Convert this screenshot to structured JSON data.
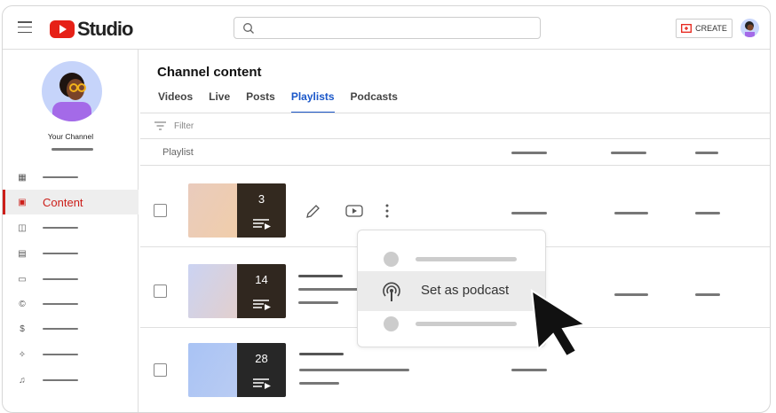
{
  "header": {
    "logo_text": "Studio",
    "create_label": "CREATE",
    "search_placeholder": ""
  },
  "sidebar": {
    "channel_name": "Your Channel",
    "active_item": "Content"
  },
  "main": {
    "title": "Channel content",
    "tabs": [
      {
        "label": "Videos"
      },
      {
        "label": "Live"
      },
      {
        "label": "Posts"
      },
      {
        "label": "Playlists",
        "selected": true
      },
      {
        "label": "Podcasts"
      }
    ],
    "filter_label": "Filter",
    "column_playlist": "Playlist",
    "rows": [
      {
        "count": "3"
      },
      {
        "count": "14"
      },
      {
        "count": "28"
      }
    ]
  },
  "menu": {
    "highlighted": "Set as podcast"
  },
  "colors": {
    "accent": "#1a57c9",
    "brand": "#e62117",
    "active": "#cc1f1a"
  }
}
